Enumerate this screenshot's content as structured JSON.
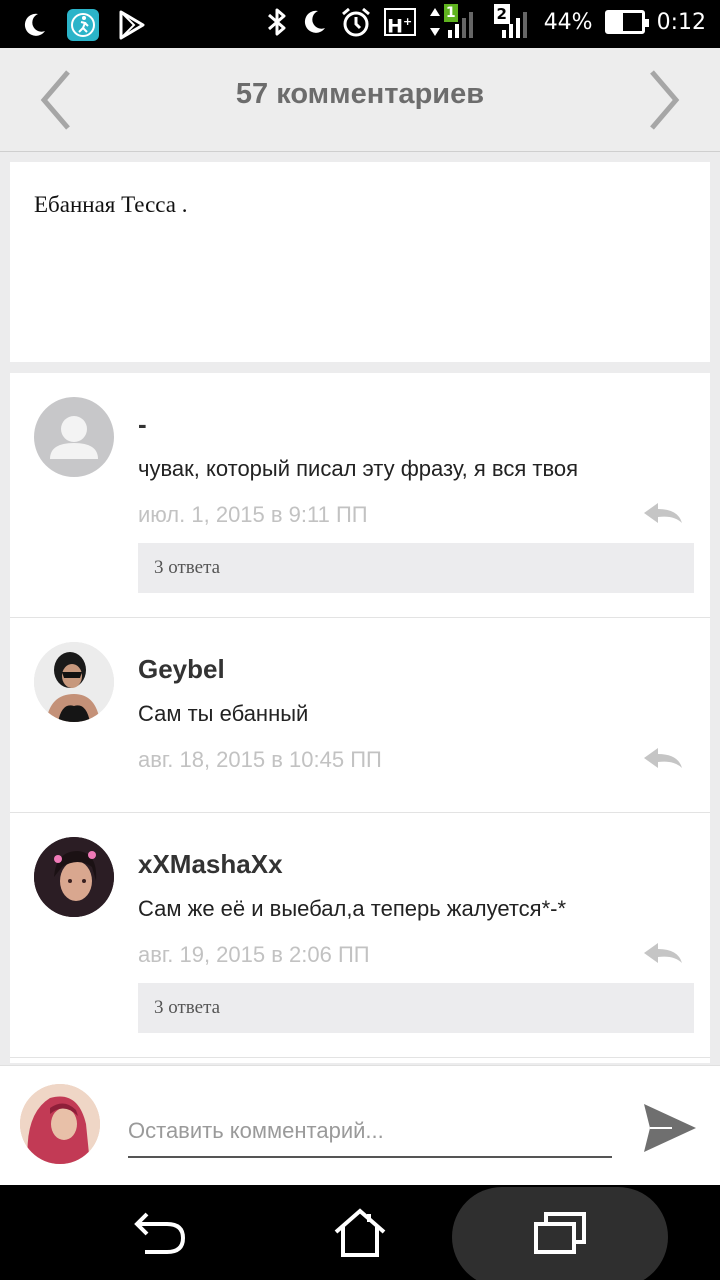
{
  "status_bar": {
    "battery_percent": "44%",
    "battery_level": 0.44,
    "time": "0:12",
    "network_type": "H",
    "network_plus": "+",
    "sim1_label": "1",
    "sim2_label": "2",
    "icons": [
      "moon-icon",
      "app-shortcut-icon",
      "play-store-icon",
      "bluetooth-icon",
      "moon-icon",
      "alarm-icon"
    ]
  },
  "header": {
    "title": "57 комментариев",
    "prev_icon": "chevron-left-icon",
    "next_icon": "chevron-right-icon"
  },
  "post": {
    "text": "Ебанная Тесса ."
  },
  "comments": [
    {
      "author": "-",
      "text": "чувак, который писал эту фразу, я вся твоя",
      "date": "июл. 1, 2015 в 9:11 ПП",
      "replies": "3 ответа",
      "avatar": "default-avatar-icon"
    },
    {
      "author": "Geybel",
      "text": "Сам ты ебанный",
      "date": "авг. 18, 2015 в 10:45 ПП",
      "replies": "",
      "avatar": "user-avatar"
    },
    {
      "author": "xXMashaXx",
      "text": "Сам же её и выебал,а теперь жалуется*-*",
      "date": "авг. 19, 2015 в 2:06 ПП",
      "replies": "3 ответа",
      "avatar": "user-avatar"
    }
  ],
  "composer": {
    "placeholder": "Оставить комментарий...",
    "send_icon": "send-icon"
  },
  "nav_bar": {
    "icons": [
      "back-icon",
      "home-icon",
      "recent-apps-icon"
    ]
  },
  "colors": {
    "header_bg": "#ededed",
    "title": "#6c6c6c",
    "date": "#c2c2c2",
    "replies_bg": "#ececee"
  }
}
